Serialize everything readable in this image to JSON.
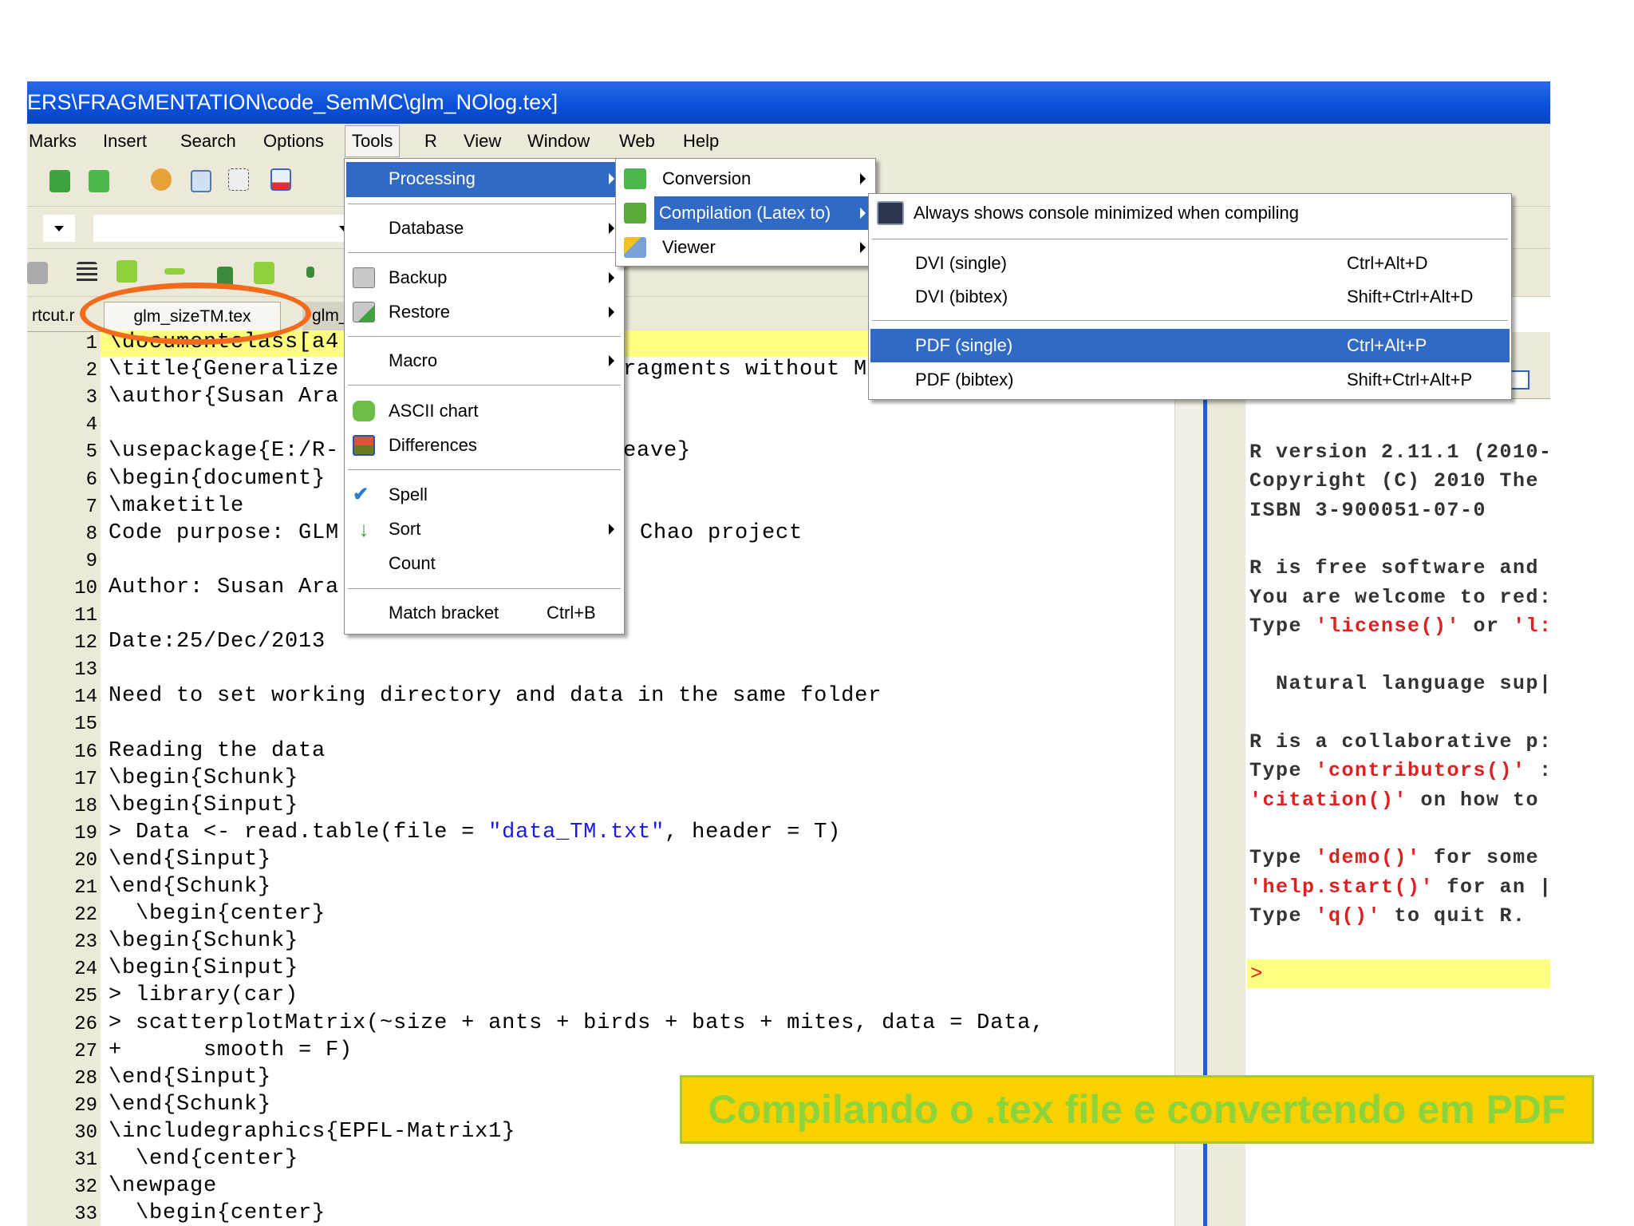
{
  "window": {
    "title": "ERS\\FRAGMENTATION\\code_SemMC\\glm_NOlog.tex]"
  },
  "menubar": [
    "Marks",
    "Insert",
    "Search",
    "Options",
    "Tools",
    "R",
    "View",
    "Window",
    "Web",
    "Help"
  ],
  "tabs": {
    "left": "rtcut.r",
    "active": "glm_sizeTM.tex",
    "right": "glm_"
  },
  "editor": {
    "lines": [
      {
        "n": "1",
        "t": "\\documentclass[a4"
      },
      {
        "n": "2",
        "t": "\\title{Generalize",
        "r": "ragments without M"
      },
      {
        "n": "3",
        "t": "\\author{Susan Ara"
      },
      {
        "n": "4",
        "t": ""
      },
      {
        "n": "5",
        "t": "\\usepackage{E:/R-",
        "r": "eave}"
      },
      {
        "n": "6",
        "t": "\\begin{document}"
      },
      {
        "n": "7",
        "t": "\\maketitle"
      },
      {
        "n": "8",
        "t": "Code purpose: GLM",
        "r": "Chao project"
      },
      {
        "n": "9",
        "t": ""
      },
      {
        "n": "10",
        "t": "Author: Susan Ara"
      },
      {
        "n": "11",
        "t": ""
      },
      {
        "n": "12",
        "t": "Date:25/Dec/2013"
      },
      {
        "n": "13",
        "t": ""
      },
      {
        "n": "14",
        "t": "Need to set working directory and data in the same folder"
      },
      {
        "n": "15",
        "t": ""
      },
      {
        "n": "16",
        "t": "Reading the data"
      },
      {
        "n": "17",
        "t": "\\begin{Schunk}"
      },
      {
        "n": "18",
        "t": "\\begin{Sinput}"
      },
      {
        "n": "19",
        "t": "> Data <- read.table(file = ",
        "s": "\"data_TM.txt\"",
        "a": ", header = T)"
      },
      {
        "n": "20",
        "t": "\\end{Sinput}"
      },
      {
        "n": "21",
        "t": "\\end{Schunk}"
      },
      {
        "n": "22",
        "t": "  \\begin{center}"
      },
      {
        "n": "23",
        "t": "\\begin{Schunk}"
      },
      {
        "n": "24",
        "t": "\\begin{Sinput}"
      },
      {
        "n": "25",
        "t": "> library(car)"
      },
      {
        "n": "26",
        "t": "> scatterplotMatrix(~size + ants + birds + bats + mites, data = Data,"
      },
      {
        "n": "27",
        "t": "+      smooth = F)"
      },
      {
        "n": "28",
        "t": "\\end{Sinput}"
      },
      {
        "n": "29",
        "t": "\\end{Schunk}"
      },
      {
        "n": "30",
        "t": "\\includegraphics{EPFL-Matrix1}"
      },
      {
        "n": "31",
        "t": "  \\end{center}"
      },
      {
        "n": "32",
        "t": "\\newpage"
      },
      {
        "n": "33",
        "t": "  \\begin{center}"
      }
    ]
  },
  "console": {
    "lines": [
      [
        [
          "R version 2.11.1 (2010-",
          "k"
        ]
      ],
      [
        [
          "Copyright (C) 2010 The",
          "k"
        ]
      ],
      [
        [
          "ISBN 3-900051-07-0",
          "k"
        ]
      ],
      [],
      [
        [
          "R is free software and",
          "k"
        ]
      ],
      [
        [
          "You are welcome to red:",
          "k"
        ]
      ],
      [
        [
          "Type ",
          "k"
        ],
        [
          "'license()'",
          "s"
        ],
        [
          " or ",
          "k"
        ],
        [
          "'l:",
          "s"
        ]
      ],
      [],
      [
        [
          "  Natural language sup|",
          "k"
        ]
      ],
      [],
      [
        [
          "R is a collaborative p:",
          "k"
        ]
      ],
      [
        [
          "Type ",
          "k"
        ],
        [
          "'contributors()'",
          "s"
        ],
        [
          " :",
          "k"
        ]
      ],
      [
        [
          "'citation()'",
          "s"
        ],
        [
          " on how to",
          "k"
        ]
      ],
      [],
      [
        [
          "Type ",
          "k"
        ],
        [
          "'demo()'",
          "s"
        ],
        [
          " for some",
          "k"
        ]
      ],
      [
        [
          "'help.start()'",
          "s"
        ],
        [
          " for an |",
          "k"
        ]
      ],
      [
        [
          "Type ",
          "k"
        ],
        [
          "'q()'",
          "s"
        ],
        [
          " to quit R.",
          "k"
        ]
      ]
    ],
    "prompt": ">"
  },
  "tools_menu": {
    "processing": "Processing",
    "database": "Database",
    "backup": "Backup",
    "restore": "Restore",
    "macro": "Macro",
    "ascii_chart": "ASCII chart",
    "differences": "Differences",
    "spell": "Spell",
    "sort": "Sort",
    "count": "Count",
    "match_bracket": "Match bracket",
    "match_bracket_shortcut": "Ctrl+B"
  },
  "processing_menu": {
    "conversion": "Conversion",
    "compilation": "Compilation (Latex to)",
    "viewer": "Viewer"
  },
  "compilation_menu": {
    "console_option": "Always shows console minimized when compiling",
    "items": [
      {
        "label": "DVI (single)",
        "shortcut": "Ctrl+Alt+D"
      },
      {
        "label": "DVI (bibtex)",
        "shortcut": "Shift+Ctrl+Alt+D"
      },
      {
        "label": "PDF (single)",
        "shortcut": "Ctrl+Alt+P"
      },
      {
        "label": "PDF (bibtex)",
        "shortcut": "Shift+Ctrl+Alt+P"
      }
    ]
  },
  "caption": "Compilando o .tex file e convertendo em PDF"
}
